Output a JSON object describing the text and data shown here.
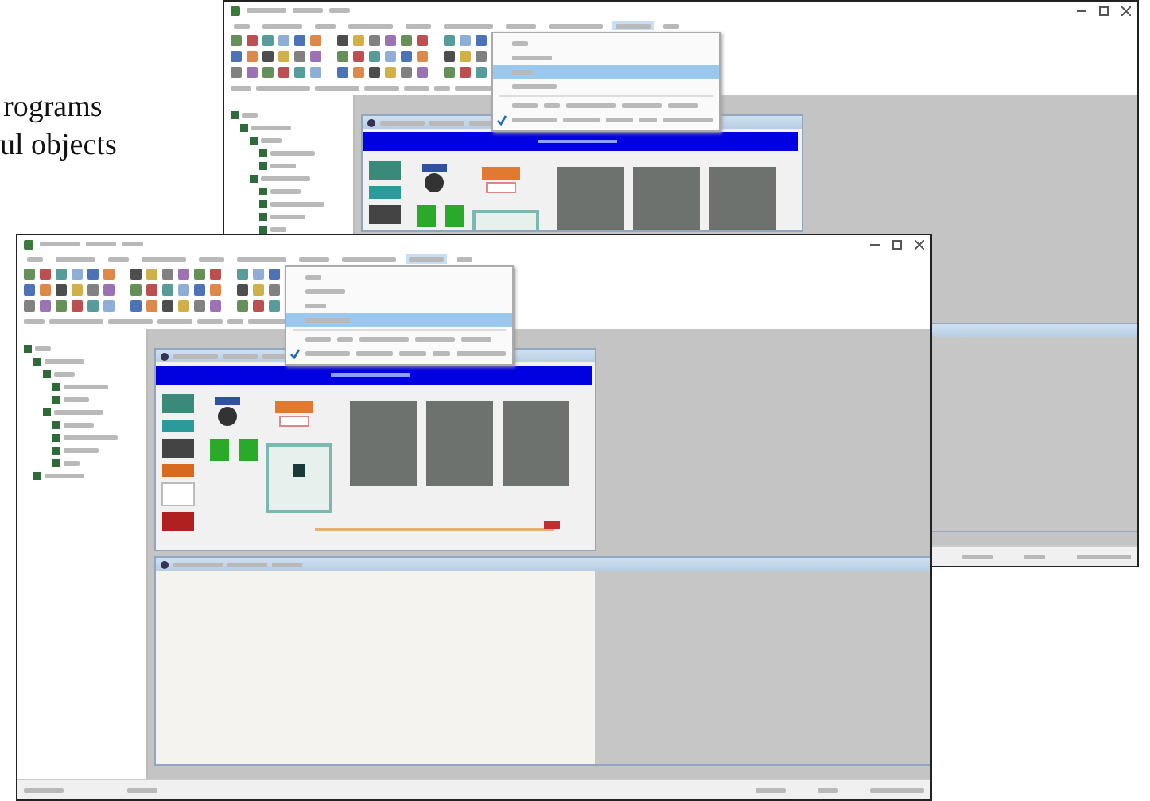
{
  "caption": {
    "lines": [
      "rograms",
      "ul objects"
    ]
  },
  "windows": [
    {
      "menus": [
        {
          "selected": false
        },
        {
          "selected": false
        },
        {
          "selected": false
        },
        {
          "selected": false
        },
        {
          "selected": false
        },
        {
          "selected": false
        },
        {
          "selected": false
        },
        {
          "selected": false
        },
        {
          "selected": true
        },
        {
          "selected": false
        }
      ],
      "menu_items": [
        {
          "selected": false,
          "checked": false
        },
        {
          "selected": false,
          "checked": false
        },
        {
          "selected": true,
          "checked": false
        },
        {
          "selected": false,
          "checked": false
        },
        {
          "selected": false,
          "checked": false
        },
        {
          "selected": false,
          "checked": true
        }
      ]
    },
    {
      "menus": [
        {
          "selected": false
        },
        {
          "selected": false
        },
        {
          "selected": false
        },
        {
          "selected": false
        },
        {
          "selected": false
        },
        {
          "selected": false
        },
        {
          "selected": false
        },
        {
          "selected": false
        },
        {
          "selected": true
        },
        {
          "selected": false
        }
      ],
      "menu_items": [
        {
          "selected": false,
          "checked": false
        },
        {
          "selected": false,
          "checked": false
        },
        {
          "selected": false,
          "checked": false
        },
        {
          "selected": true,
          "checked": false
        },
        {
          "selected": false,
          "checked": false
        },
        {
          "selected": false,
          "checked": true
        }
      ]
    }
  ]
}
